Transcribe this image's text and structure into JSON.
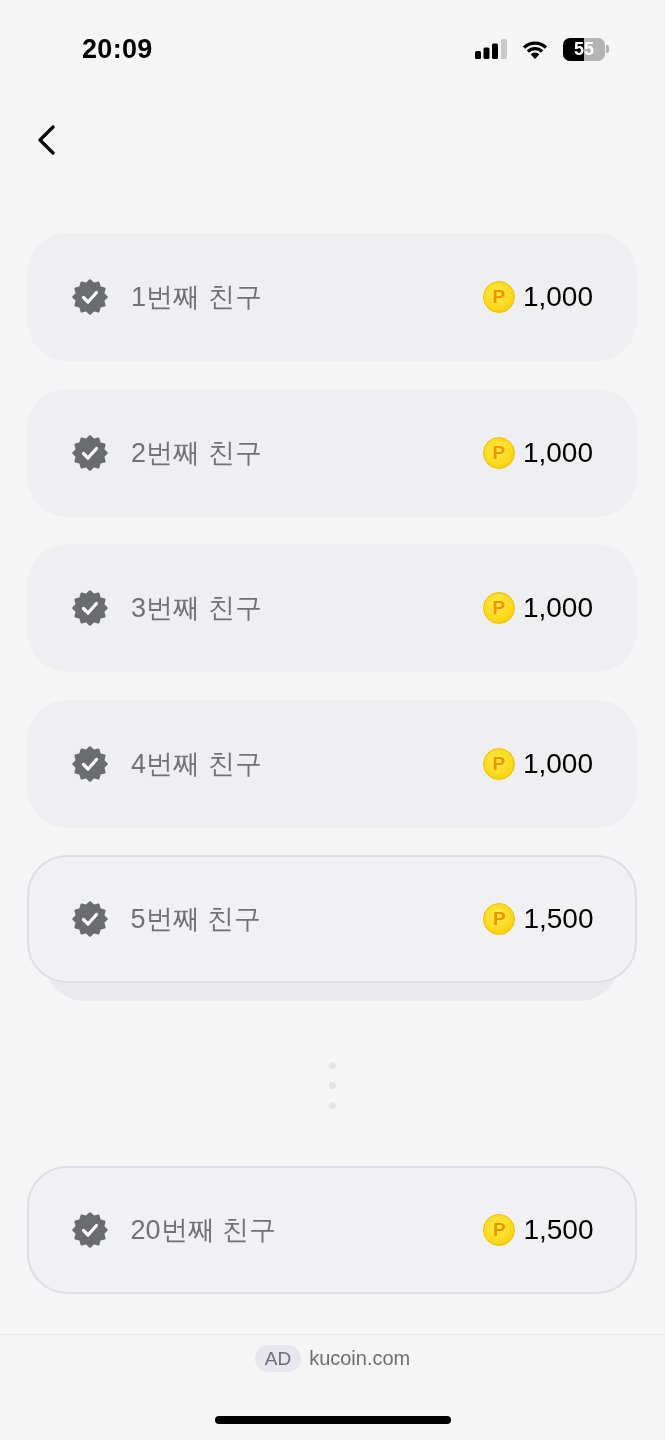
{
  "status_bar": {
    "time": "20:09",
    "battery": "55"
  },
  "friends": [
    {
      "label": "1번째 친구",
      "coin": "P",
      "points": "1,000",
      "outlined": false,
      "stacked": false
    },
    {
      "label": "2번째 친구",
      "coin": "P",
      "points": "1,000",
      "outlined": false,
      "stacked": false
    },
    {
      "label": "3번째 친구",
      "coin": "P",
      "points": "1,000",
      "outlined": false,
      "stacked": false
    },
    {
      "label": "4번째 친구",
      "coin": "P",
      "points": "1,000",
      "outlined": false,
      "stacked": false
    },
    {
      "label": "5번째 친구",
      "coin": "P",
      "points": "1,500",
      "outlined": true,
      "stacked": true
    },
    {
      "label": "20번째 친구",
      "coin": "P",
      "points": "1,500",
      "outlined": true,
      "stacked": false
    }
  ],
  "ad": {
    "badge": "AD",
    "domain": "kucoin.com"
  }
}
